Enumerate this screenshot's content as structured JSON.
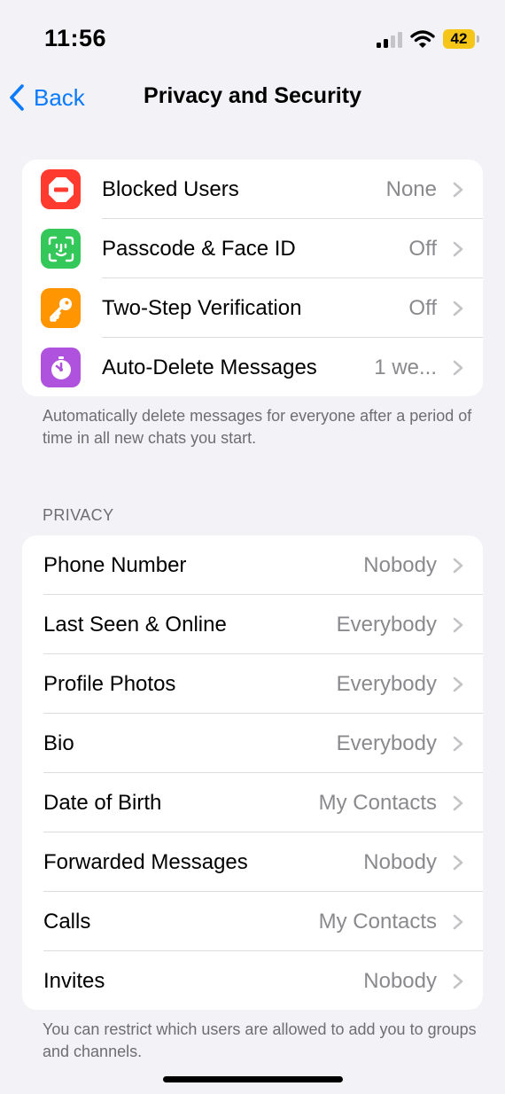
{
  "status_bar": {
    "time": "11:56",
    "battery_level": "42",
    "signal_bars_active": 2,
    "signal_bars_total": 4
  },
  "nav": {
    "back_label": "Back",
    "title": "Privacy and Security"
  },
  "security_rows": [
    {
      "label": "Blocked Users",
      "value": "None",
      "icon": "blocked-icon",
      "color": "#ff3b30"
    },
    {
      "label": "Passcode & Face ID",
      "value": "Off",
      "icon": "face-id-icon",
      "color": "#34c759"
    },
    {
      "label": "Two-Step Verification",
      "value": "Off",
      "icon": "key-icon",
      "color": "#ff9500"
    },
    {
      "label": "Auto-Delete Messages",
      "value": "1 we...",
      "icon": "timer-icon",
      "color": "#af52de"
    }
  ],
  "security_footer": "Automatically delete messages for everyone after a period of time in all new chats you start.",
  "privacy_header": "PRIVACY",
  "privacy_rows": [
    {
      "label": "Phone Number",
      "value": "Nobody"
    },
    {
      "label": "Last Seen & Online",
      "value": "Everybody"
    },
    {
      "label": "Profile Photos",
      "value": "Everybody"
    },
    {
      "label": "Bio",
      "value": "Everybody"
    },
    {
      "label": "Date of Birth",
      "value": "My Contacts"
    },
    {
      "label": "Forwarded Messages",
      "value": "Nobody"
    },
    {
      "label": "Calls",
      "value": "My Contacts"
    },
    {
      "label": "Invites",
      "value": "Nobody"
    }
  ],
  "privacy_footer": "You can restrict which users are allowed to add you to groups and channels.",
  "colors": {
    "accent": "#0a7aff",
    "background": "#f2f2f7",
    "secondary_text": "#8a8a8e",
    "battery": "#f5c518"
  }
}
